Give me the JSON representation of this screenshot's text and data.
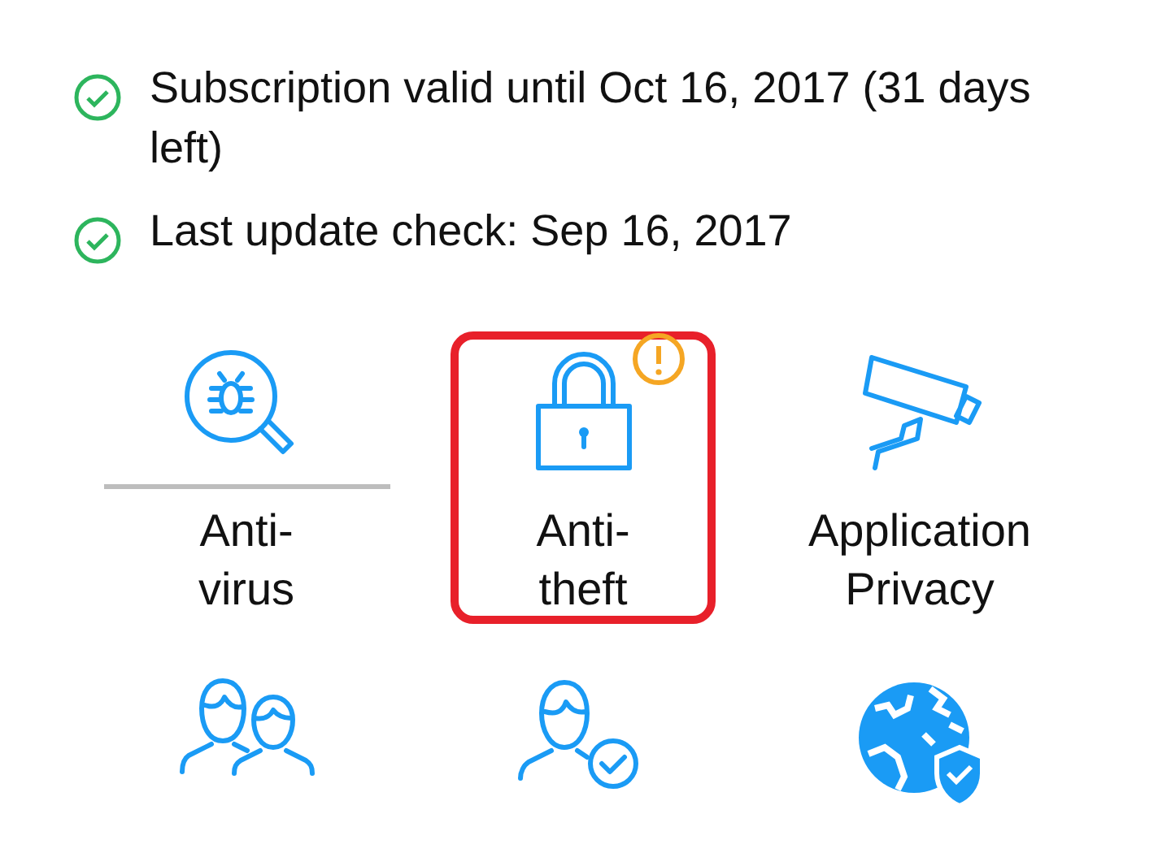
{
  "status": [
    {
      "text": "Subscription valid until Oct 16, 2017 (31 days left)"
    },
    {
      "text": "Last update check: Sep 16, 2017"
    }
  ],
  "features": [
    {
      "kind": "bug-search",
      "label": "Anti-\nvirus",
      "selected": true,
      "highlighted": false,
      "warning": false
    },
    {
      "kind": "lock",
      "label": "Anti-\ntheft",
      "selected": false,
      "highlighted": true,
      "warning": true
    },
    {
      "kind": "camera",
      "label": "Application\nPrivacy",
      "selected": false,
      "highlighted": false,
      "warning": false
    },
    {
      "kind": "people",
      "selected": false,
      "highlighted": false,
      "warning": false
    },
    {
      "kind": "person-check",
      "selected": false,
      "highlighted": false,
      "warning": false
    },
    {
      "kind": "globe-shield",
      "selected": false,
      "highlighted": false,
      "warning": false
    }
  ]
}
